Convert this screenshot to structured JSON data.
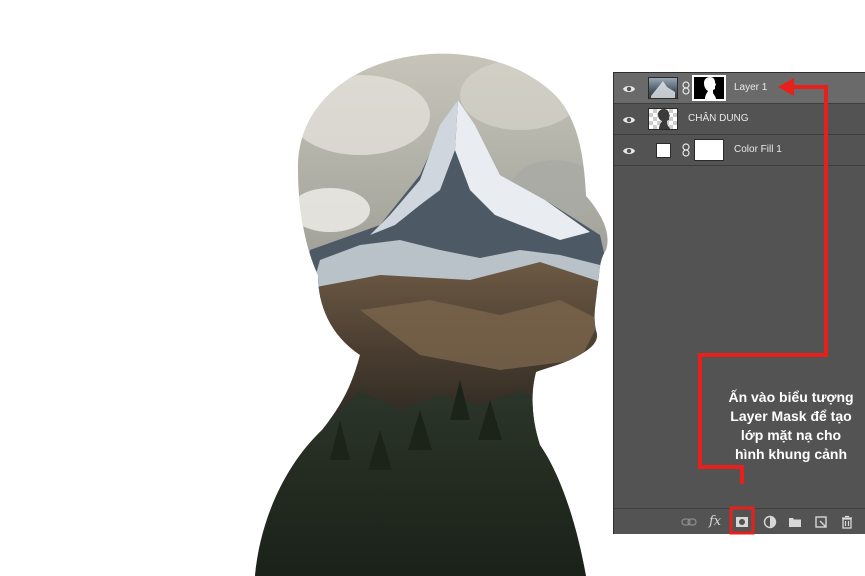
{
  "layers_panel": {
    "layers": [
      {
        "name": "Layer 1",
        "selected": true,
        "thumbnail": "mountain-photo-thumbnail",
        "mask": "silhouette-mask-thumbnail"
      },
      {
        "name": "CHÂN DUNG",
        "selected": false,
        "thumbnail": "portrait-silhouette-thumbnail"
      },
      {
        "name": "Color Fill 1",
        "selected": false,
        "thumbnail": "white-color-swatch",
        "mask": "white-mask-thumbnail"
      }
    ],
    "footer_icons": [
      "link-layers-icon",
      "fx-icon",
      "layer-mask-icon",
      "adjustment-layer-icon",
      "folder-icon",
      "new-layer-icon",
      "trash-icon"
    ],
    "fx_label": "fx"
  },
  "annotation": {
    "lines": [
      "Ấn vào biểu tượng",
      "Layer Mask để tạo",
      "lớp mặt nạ cho",
      "hình khung cảnh"
    ],
    "color": "#e8201c"
  },
  "artwork": {
    "subject": "double exposure portrait silhouette filled with snowy mountain and pine forest"
  }
}
